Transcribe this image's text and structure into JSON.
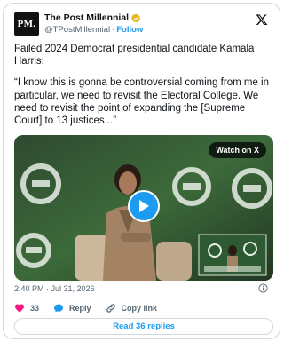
{
  "author": {
    "avatar_text": "PM.",
    "name": "The Post Millennial",
    "handle": "@TPostMillennial",
    "separator": "·",
    "follow_label": "Follow"
  },
  "tweet": {
    "paragraph1": "Failed 2024 Democrat presidential candidate Kamala Harris:",
    "paragraph2": "“I know this is gonna be controversial coming from me in particular, we need to revisit the Electoral College. We need to revisit the point of expanding the [Supreme Court] to 13 justices...”"
  },
  "media": {
    "watch_label": "Watch on X"
  },
  "timestamp": "2:40 PM · Jul 31, 2026",
  "actions": {
    "like_count": "33",
    "reply_label": "Reply",
    "copy_label": "Copy link"
  },
  "read_replies_label": "Read 36 replies",
  "colors": {
    "accent": "#1d9bf0",
    "like": "#f91880",
    "verified": "#e2b719"
  }
}
